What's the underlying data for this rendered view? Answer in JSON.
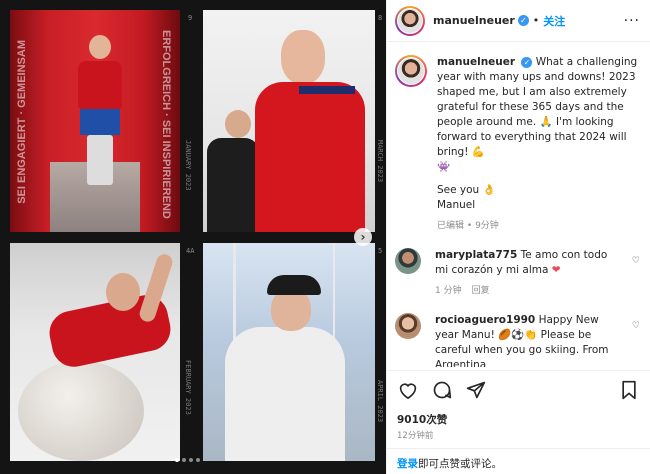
{
  "post": {
    "username": "manuelneuer",
    "follow_label": "关注",
    "separator": "•",
    "more_label": "···"
  },
  "media": {
    "panel1": {
      "wall_left": "SEI ENGAGIERT · GEMEINSAM",
      "wall_right": "ERFOLGREICH · SEI INSPIRIEREND",
      "side_text": "JANUARY 2023",
      "num": "9"
    },
    "panel2": {
      "side_text": "MARCH 2023",
      "num": "8"
    },
    "panel3": {
      "side_text": "FEBRUARY 2023",
      "num": "4A"
    },
    "panel4": {
      "side_text": "APRIL 2023",
      "num": "5"
    },
    "carousel_dots": 4,
    "active_dot": 0
  },
  "caption": {
    "username": "manuelneuer",
    "text": "What a challenging year with many ups and downs! 2023 shaped me, but I am also extremely grateful for these 365 days and the people around me. 🙏 I'm looking forward to everything that 2024 will bring! 💪",
    "emoji_line": "👾",
    "signoff1": "See you 👌",
    "signoff2": "Manuel",
    "edited_label": "已编辑",
    "time_ago": "9分钟"
  },
  "comments": [
    {
      "username": "maryplata775",
      "text": "Te amo con todo mi corazón y mi alma",
      "time_ago": "1 分钟",
      "reply_label": "回复"
    },
    {
      "username": "rocioaguero1990",
      "text": "Happy New year Manu! 🏉⚽👏 Please be careful when you go skiing. From Argentina"
    }
  ],
  "likes_text": "9010次赞",
  "post_time": "12分钟前",
  "login_link": "登录",
  "login_text": "即可点赞或评论。",
  "colors": {
    "accent": "#0095f6",
    "verified": "#3897f0",
    "heart": "#ed4956"
  }
}
